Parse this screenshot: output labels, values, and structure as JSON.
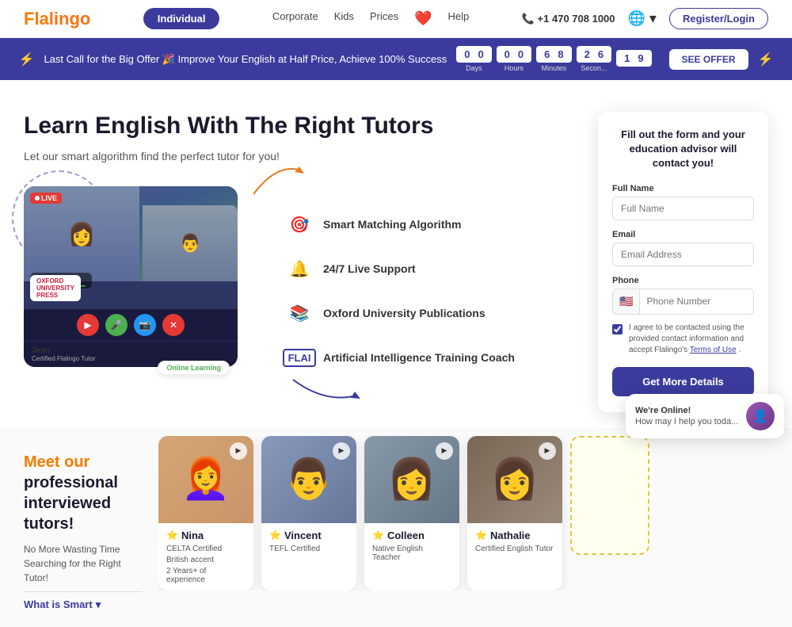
{
  "navbar": {
    "logo_text": "Fla",
    "logo_accent": "lingo",
    "nav_active": "Individual",
    "links": [
      "Corporate",
      "Kids",
      "Prices"
    ],
    "heart": "❤️",
    "help": "Help",
    "phone": "+1 470 708 1000",
    "globe_label": "🌐",
    "register_label": "Register/Login"
  },
  "promo": {
    "text": "Last Call for the Big Offer 🎉 Improve Your English at Half Price, Achieve 100% Success",
    "timer": {
      "days": [
        "0",
        "0"
      ],
      "hours": [
        "0",
        "0"
      ],
      "minutes": [
        "6",
        "8"
      ],
      "seconds": [
        "2",
        "6"
      ],
      "ms": [
        "1",
        "9"
      ]
    },
    "timer_labels": [
      "Days",
      "Hours",
      "Minutes",
      "Secon...",
      ""
    ],
    "cta": "SEE OFFER"
  },
  "hero": {
    "title": "Learn English With The Right Tutors",
    "subtitle": "Let our smart algorithm find the perfect tutor for you!",
    "live_badge": "●LIVE",
    "oxford_badge": "OXFORD UNIVERSITY PRESS",
    "online_label": "Online Learning",
    "tutor_name": "Jean",
    "tutor_tag": "Certified Flalingo Tutor"
  },
  "features": [
    {
      "icon": "🎯",
      "text": "Smart Matching Algorithm"
    },
    {
      "icon": "🔔",
      "text": "24/7 Live Support"
    },
    {
      "icon": "📚",
      "text": "Oxford University Publications"
    },
    {
      "icon": "FLAI",
      "text": "Artificial Intelligence Training Coach"
    }
  ],
  "form": {
    "title": "Fill out the form and your education advisor will contact you!",
    "full_name_label": "Full Name",
    "full_name_placeholder": "Full Name",
    "email_label": "Email",
    "email_placeholder": "Email Address",
    "phone_label": "Phone",
    "phone_placeholder": "Phone Number",
    "phone_flag": "🇺🇸",
    "checkbox_text": "I agree to be contacted using the provided contact information and accept Flalingo's Terms of Use .",
    "terms_link": "Terms of Use",
    "submit_label": "Get More Details"
  },
  "tutors_section": {
    "meet_label": "Meet our",
    "professional_label": "professional interviewed tutors!",
    "sub_text": "No More Wasting Time Searching for the Right Tutor!",
    "what_is": "What is Smart"
  },
  "tutors": [
    {
      "name": "Nina",
      "cert": "CELTA Certified",
      "accent": "British accent",
      "experience": "2 Years+ of experience",
      "star": "⭐"
    },
    {
      "name": "Vincent",
      "cert": "TEFL Certified",
      "accent": "",
      "experience": "",
      "star": "⭐"
    },
    {
      "name": "Colleen",
      "cert": "Native English Teacher",
      "accent": "",
      "experience": "",
      "star": "⭐"
    },
    {
      "name": "Nathalie",
      "cert": "Certified English Tutor",
      "accent": "",
      "experience": "",
      "star": "⭐"
    }
  ],
  "chatbot": {
    "title": "We're Online!",
    "message": "How may I help you toda...",
    "avatar_emoji": "👤"
  }
}
